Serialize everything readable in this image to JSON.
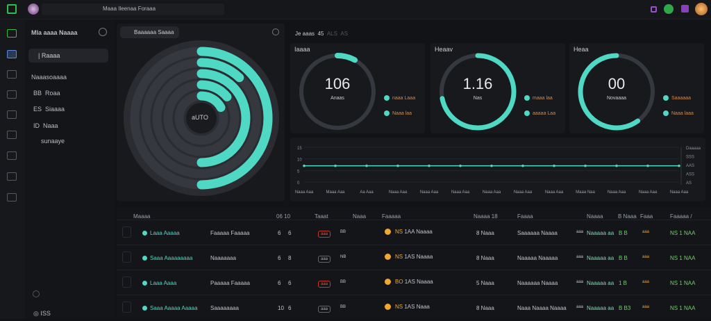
{
  "topbar": {
    "search_text": "Maaa Ileenaa Foraaa",
    "right_icons": [
      "purple-square-icon",
      "green-leaf-icon",
      "purple-badge-icon",
      "user-avatar"
    ]
  },
  "rail": {
    "icons": [
      "logo-icon",
      "dashboard-icon",
      "grid-icon",
      "alert-icon",
      "layers-icon",
      "box-icon",
      "table-icon",
      "chart-icon",
      "list-icon"
    ]
  },
  "sidebar": {
    "title": "Mla aaaa Naaaa",
    "active_item": "| Raaaa",
    "section": "Naaasoaaaa",
    "items": [
      {
        "prefix": "BB",
        "label": "Roaa"
      },
      {
        "prefix": "ES",
        "label": "Siaaaa"
      },
      {
        "prefix": "ID",
        "label": "Naaa"
      },
      {
        "prefix": "",
        "label": "sunaaye"
      }
    ],
    "footer": "ISS"
  },
  "radial": {
    "button": "Baaaaaa Saaaa",
    "center_label": "aUTO",
    "rings": [
      0.5,
      0.12,
      0.5,
      0.14,
      0.17
    ]
  },
  "gauges": {
    "header": "Je aaas",
    "header_tabs": [
      "45",
      "ALS",
      "AS"
    ],
    "items": [
      {
        "title": "Iaaaa",
        "value": "106",
        "sub": "Anaas",
        "fraction": 0.08,
        "legend": [
          "naaa Laaa",
          "Naaa laa"
        ]
      },
      {
        "title": "Heaav",
        "value": "1.16",
        "sub": "Nas",
        "fraction": 0.72,
        "legend": [
          "maaa laa",
          "aaaaa Laa"
        ]
      },
      {
        "title": "Heaa",
        "value": "00",
        "sub": "Novaaaa",
        "fraction": 0.6,
        "legend": [
          "Saaaaaa",
          "Naaa laaa"
        ]
      }
    ]
  },
  "line_chart": {
    "chart_data": {
      "type": "line",
      "y_left_ticks": [
        "15",
        "10",
        "5",
        "0"
      ],
      "y_right_ticks": [
        "Daaaaa",
        "SSS",
        "AAS",
        "ASS",
        "AS"
      ],
      "x_labels": [
        "Naaa Aaa",
        "Maaa Aaa",
        "Aa Aaa",
        "Naaa Aaa",
        "Naaa Aaa",
        "Naaa Aaa",
        "Naaa Aaa",
        "Naaa Aaa",
        "Naaa Aaa",
        "Maaa Naa",
        "Naaa Aaa",
        "Naaa Aaa",
        "Naaa Aaa"
      ],
      "values": [
        7,
        7,
        7,
        7,
        7,
        7,
        7,
        7,
        7,
        7,
        7,
        7,
        7
      ],
      "ylim": [
        0,
        15
      ],
      "color": "#4fd8c4"
    }
  },
  "table": {
    "headers": [
      "Maaaa",
      "06 10",
      "Taaat",
      "Naaa",
      "Faaaaa",
      "Naaaa 18",
      "Faaaa",
      "Naaaa",
      "B Naaa",
      "Faaa",
      "Faaaaa /"
    ],
    "rows": [
      {
        "name": "Laaa Aaaaa",
        "desc": "Faaaaa Faaaaa",
        "n1": "6",
        "n2": "6",
        "badge": "aaa",
        "badge_red": true,
        "code": "BB",
        "cur": "NS",
        "c2": "1AA",
        "c3": "Naaaa",
        "count": "8 Naaa",
        "loc": "Saaaaaa Naaaa",
        "l2": "aaa",
        "status": "Naaaaa aa",
        "g": "B B",
        "y": "aaa",
        "end": "NS 1 NAA"
      },
      {
        "name": "Saaa Aaaaaaaaa",
        "desc": "Naaaaaaa",
        "n1": "6",
        "n2": "8",
        "badge": "aaa",
        "badge_red": false,
        "code": "NB",
        "cur": "NS",
        "c2": "1AS",
        "c3": "Naaaa",
        "count": "8 Naaa",
        "loc": "Naaaaa Naaaaa",
        "l2": "aaa",
        "status": "Naaaaa aa",
        "g": "B B",
        "y": "aaa",
        "end": "NS 1 NAA"
      },
      {
        "name": "Laaa Aaaa",
        "desc": "Paaaaa Faaaaa",
        "n1": "6",
        "n2": "6",
        "badge": "aaa",
        "badge_red": true,
        "code": "BB",
        "cur": "BO",
        "c2": "1AS",
        "c3": "Naaaa",
        "count": "5 Naaa",
        "loc": "Naaaaaa Naaaa",
        "l2": "aaa",
        "status": "Naaaaa aa",
        "g": "1 B",
        "y": "aaa",
        "end": "NS 1 NAA"
      },
      {
        "name": "Saaa Aaaaa Aaaaa",
        "desc": "Saaaaaaaa",
        "n1": "10",
        "n2": "6",
        "badge": "aaa",
        "badge_red": false,
        "code": "BB",
        "cur": "NS",
        "c2": "1AS",
        "c3": "Naaa",
        "count": "8 Naaa",
        "loc": "Naaa Naaaa Naaaa",
        "l2": "aaa",
        "status": "Naaaaa aa",
        "g": "B B3",
        "y": "aaa",
        "end": "NS 1 NAA"
      }
    ]
  },
  "colors": {
    "accent": "#4fd8c4",
    "ring_bg": "#35383e",
    "orange": "#f0a830",
    "green": "#6fcf6a",
    "red": "#c0392b"
  }
}
